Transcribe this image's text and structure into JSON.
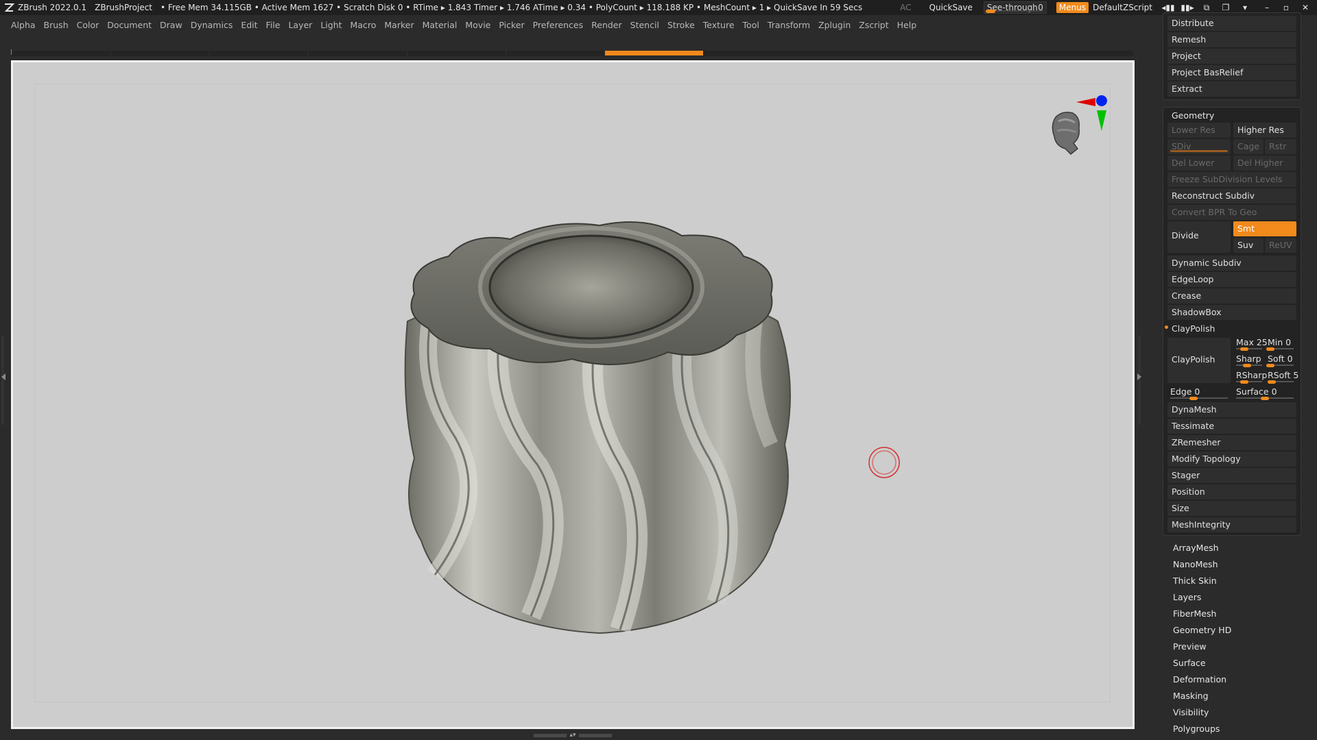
{
  "titlebar": {
    "app": "ZBrush 2022.0.1",
    "project": "ZBrushProject",
    "stats": "• Free Mem 34.115GB • Active Mem 1627 • Scratch Disk 0 •  RTime ▸ 1.843 Timer ▸ 1.746 ATime ▸ 0.34 • PolyCount ▸ 118.188 KP  • MeshCount ▸ 1   ▸ QuickSave In 59 Secs",
    "ac": "AC",
    "quicksave": "QuickSave",
    "seethrough_label": "See-through",
    "seethrough_value": "0",
    "menus": "Menus",
    "script": "DefaultZScript"
  },
  "menubar": {
    "items": [
      "Alpha",
      "Brush",
      "Color",
      "Document",
      "Draw",
      "Dynamics",
      "Edit",
      "File",
      "Layer",
      "Light",
      "Macro",
      "Marker",
      "Material",
      "Movie",
      "Picker",
      "Preferences",
      "Render",
      "Stencil",
      "Stroke",
      "Texture",
      "Tool",
      "Transform",
      "Zplugin",
      "Zscript",
      "Help"
    ]
  },
  "colors": {
    "accent": "#f28a1c",
    "canvas_bg": "#cdcdcd",
    "panel_bg": "#2b2b2b",
    "gizmo_x": "#e00000",
    "gizmo_y": "#00c000",
    "gizmo_z": "#0022ee"
  },
  "rightpanel": {
    "top_buttons": [
      "Distribute",
      "Remesh",
      "Project",
      "Project BasRelief",
      "Extract"
    ],
    "geometry": {
      "title": "Geometry",
      "lower_res": "Lower Res",
      "higher_res": "Higher Res",
      "sdiv": "SDiv",
      "cage": "Cage",
      "rstr": "Rstr",
      "del_lower": "Del Lower",
      "del_higher": "Del Higher",
      "freeze": "Freeze SubDivision Levels",
      "reconstruct": "Reconstruct Subdiv",
      "convert_bpr": "Convert BPR To Geo",
      "divide": "Divide",
      "smt": "Smt",
      "suv": "Suv",
      "reuv": "ReUV",
      "dynamic_subdiv": "Dynamic Subdiv",
      "edgeloop": "EdgeLoop",
      "crease": "Crease",
      "shadowbox": "ShadowBox",
      "claypolish_section": "ClayPolish",
      "claypolish_btn": "ClayPolish",
      "max": "Max 25",
      "min": "Min 0",
      "sharp": "Sharp",
      "soft": "Soft 0",
      "rsharp": "RSharp",
      "rsoft": "RSoft 5",
      "edge": "Edge 0",
      "surface": "Surface 0",
      "dynamesh": "DynaMesh",
      "tessimate": "Tessimate",
      "zremesher": "ZRemesher",
      "modify_topology": "Modify Topology",
      "stager": "Stager",
      "position": "Position",
      "size": "Size",
      "meshintegrity": "MeshIntegrity"
    },
    "subpalettes": [
      "ArrayMesh",
      "NanoMesh",
      "Thick Skin",
      "Layers",
      "FiberMesh",
      "Geometry HD",
      "Preview",
      "Surface",
      "Deformation",
      "Masking",
      "Visibility",
      "Polygroups"
    ]
  }
}
